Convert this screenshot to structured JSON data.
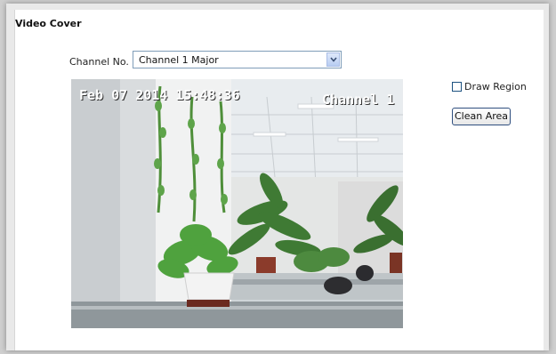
{
  "section": {
    "title": "Video Cover"
  },
  "channel": {
    "label": "Channel No.",
    "selected": "Channel 1 Major"
  },
  "video": {
    "timestamp": "Feb 07 2014 15:48:36",
    "channel_name": "Channel 1"
  },
  "controls": {
    "draw_region_label": "Draw Region",
    "draw_region_checked": false,
    "clean_area_label": "Clean Area"
  },
  "colors": {
    "select_border": "#7f9db9",
    "button_border": "#2f4f7f"
  },
  "icons": {
    "dropdown": "chevron-down-icon"
  }
}
